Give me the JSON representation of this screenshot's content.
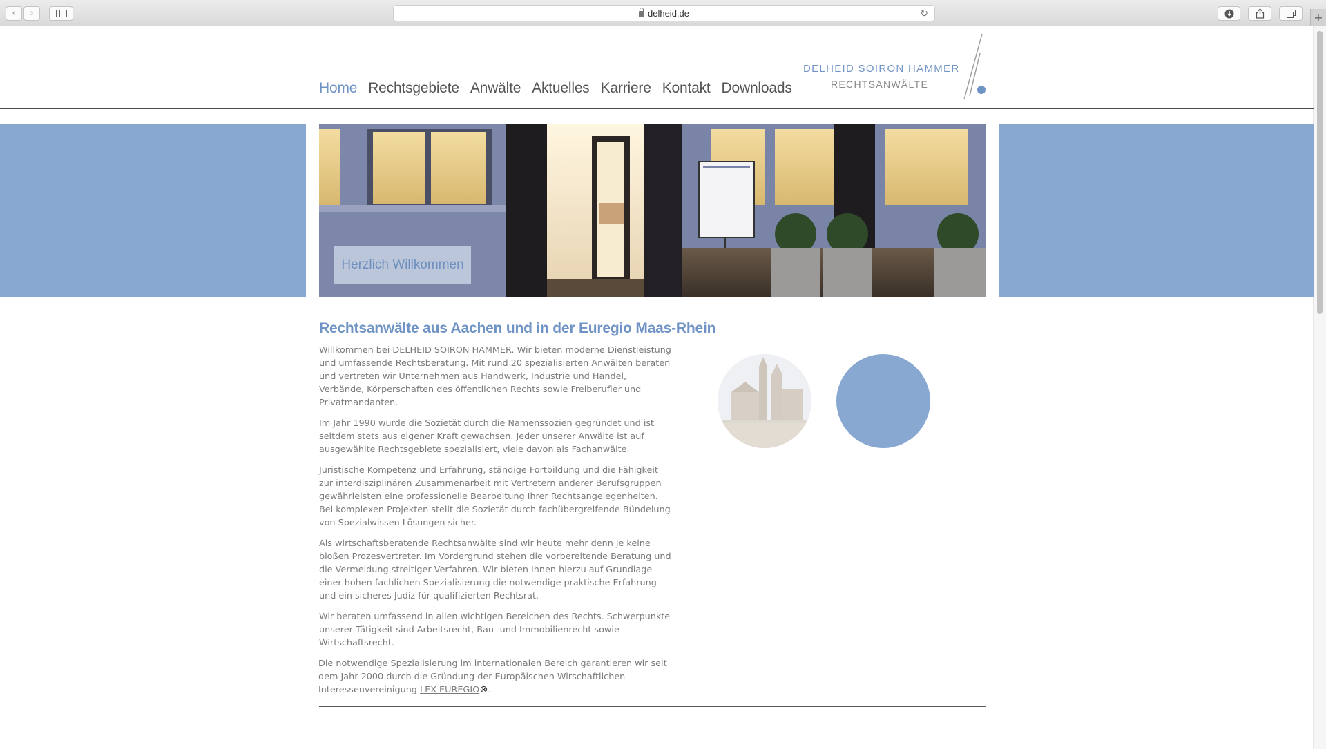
{
  "browser": {
    "url": "delheid.de",
    "back_glyph": "‹",
    "forward_glyph": "›",
    "reload_glyph": "↻",
    "new_tab_glyph": "+"
  },
  "nav": {
    "items": [
      "Home",
      "Rechtsgebiete",
      "Anwälte",
      "Aktuelles",
      "Karriere",
      "Kontakt",
      "Downloads"
    ],
    "active": "Home"
  },
  "logo": {
    "line1": "DELHEID  SOIRON  HAMMER",
    "line2": "RECHTSANWÄLTE"
  },
  "hero": {
    "caption": "Herzlich Willkommen"
  },
  "content": {
    "headline": "Rechtsanwälte aus Aachen und in der Euregio Maas-Rhein",
    "paragraphs": [
      "Willkommen bei DELHEID SOIRON HAMMER. Wir bieten moderne Dienstleistung und umfassende  Rechtsberatung. Mit rund 20 spezialisierten Anwälten beraten und vertreten wir Unternehmen aus Handwerk, Industrie und Handel, Verbände, Körperschaften des öffentlichen Rechts sowie Freiberufler und Privatmandanten.",
      "Im Jahr 1990 wurde die  Sozietät durch die Namenssozien gegründet und ist seitdem stets aus eigener Kraft gewachsen. Jeder unserer Anwälte ist auf ausgewählte Rechtsgebiete spezialisiert, viele davon als Fachanwälte.",
      "Juristische Kompetenz und Erfahrung, ständige Fortbildung und die Fähigkeit zur interdisziplinären Zusammenarbeit mit Vertretern anderer Berufsgruppen gewährleisten eine professionelle Bearbeitung Ihrer Rechtsangelegenheiten. Bei komplexen Projekten stellt die Sozietät durch fachübergreifende Bündelung von Spezialwissen Lösungen sicher.",
      "Als wirtschaftsberatende Rechtsanwälte sind wir heute mehr denn je keine bloßen Prozesvertreter. Im Vordergrund stehen die vorbereitende Beratung und die Vermeidung streitiger Verfahren. Wir bieten Ihnen hierzu auf Grundlage einer hohen fachlichen Spezialisierung die notwendige praktische Erfahrung und ein sicheres Judiz für qualifizierten Rechtsrat.",
      "Wir beraten umfassend in allen wichtigen Bereichen des Rechts. Schwerpunkte unserer Tätigkeit sind Arbeitsrecht, Bau- und Immobilienrecht sowie Wirtschaftsrecht."
    ],
    "last_paragraph_prefix": "Die notwendige Spezialisierung im internationalen Bereich garantieren wir seit dem Jahr 2000 durch die Gründung der Europäischen Wirschaftlichen Interessenvereinigung ",
    "link_text": "LEX-EUREGIO",
    "registered_mark": "®",
    "last_paragraph_suffix": "."
  },
  "colors": {
    "accent": "#88a8d2",
    "nav_active": "#6e93c4",
    "text": "#7a7a7a"
  },
  "icons": [
    "back-icon",
    "forward-icon",
    "sidebar-icon",
    "lock-icon",
    "reload-icon",
    "download-icon",
    "share-icon",
    "tabs-icon",
    "new-tab-icon"
  ]
}
